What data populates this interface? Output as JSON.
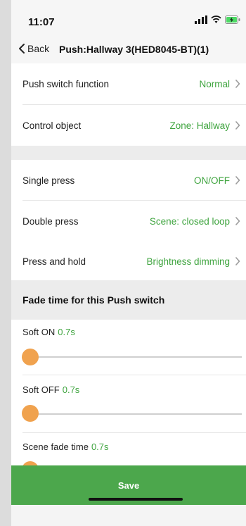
{
  "status_bar": {
    "time": "11:07"
  },
  "nav": {
    "back_label": "Back",
    "title": "Push:Hallway 3(HED8045-BT)(1)"
  },
  "settings": [
    {
      "label": "Push switch function",
      "value": "Normal"
    },
    {
      "label": "Control object",
      "value": "Zone: Hallway"
    },
    {
      "label": "Single press",
      "value": "ON/OFF"
    },
    {
      "label": "Double press",
      "value": "Scene: closed loop"
    },
    {
      "label": "Press and hold",
      "value": "Brightness dimming"
    }
  ],
  "fade_section": {
    "header": "Fade time for this Push switch",
    "sliders": [
      {
        "label": "Soft ON",
        "value": "0.7s",
        "level": 0
      },
      {
        "label": "Soft OFF",
        "value": "0.7s",
        "level": 0
      },
      {
        "label": "Scene fade time",
        "value": "0.7s",
        "level": 0
      }
    ]
  },
  "save_label": "Save",
  "colors": {
    "accent": "#3fa43f",
    "button": "#4ca74c",
    "slider_thumb": "#f0a24e"
  }
}
